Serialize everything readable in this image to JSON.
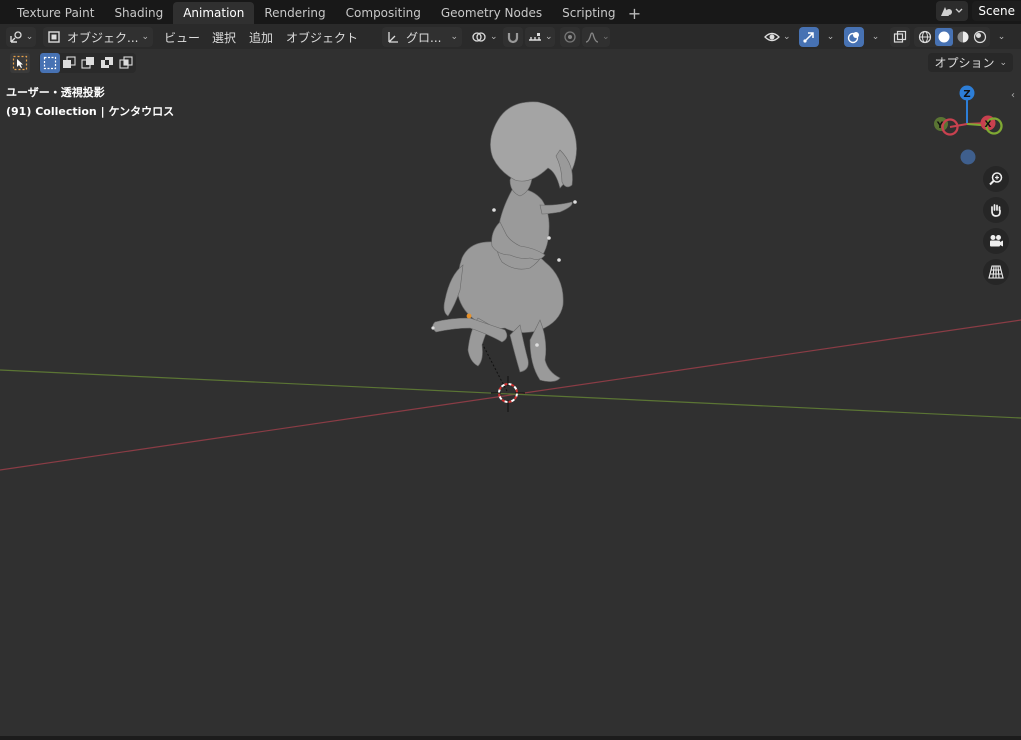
{
  "workspace_tabs": [
    {
      "label": "Texture Paint",
      "active": false
    },
    {
      "label": "Shading",
      "active": false
    },
    {
      "label": "Animation",
      "active": true
    },
    {
      "label": "Rendering",
      "active": false
    },
    {
      "label": "Compositing",
      "active": false
    },
    {
      "label": "Geometry Nodes",
      "active": false
    },
    {
      "label": "Scripting",
      "active": false
    }
  ],
  "add_tab_label": "+",
  "scene": {
    "name": "Scene"
  },
  "header": {
    "mode_label": "オブジェク...",
    "menu": {
      "view": "ビュー",
      "select": "選択",
      "add": "追加",
      "object": "オブジェクト"
    },
    "transform_orientation": "グロ..."
  },
  "options_label": "オプション",
  "viewport": {
    "view_name": "ユーザー・透視投影",
    "collection_info": "(91) Collection | ケンタウロス"
  },
  "gizmo": {
    "z": "Z",
    "y": "Y",
    "x": "X"
  },
  "colors": {
    "x_axis": "#c8414f",
    "y_axis": "#7fa933",
    "z_axis": "#2d7ed7",
    "accent": "#4772b3"
  }
}
